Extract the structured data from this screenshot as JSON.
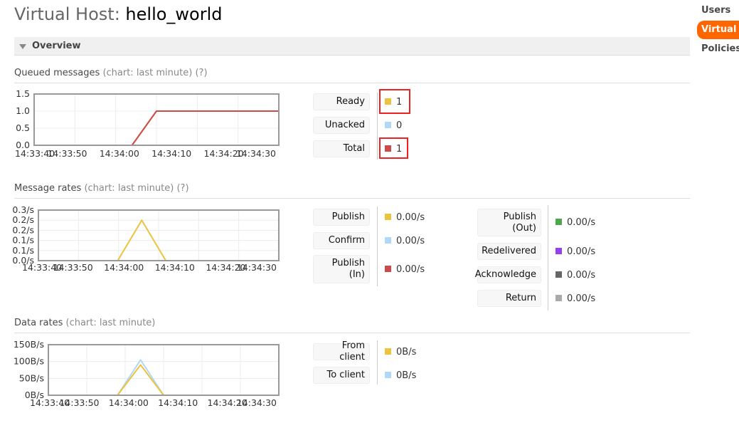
{
  "header": {
    "title_prefix": "Virtual Host: ",
    "vhost_name": "hello_world"
  },
  "nav": {
    "items": [
      "Users",
      "Virtual Hosts",
      "Policies"
    ],
    "active_index": 1
  },
  "overview": {
    "label": "Overview"
  },
  "queued": {
    "title": "Queued messages",
    "subtitle": "(chart: last minute)",
    "help": "(?)",
    "stats": [
      {
        "label": "Ready",
        "value": "1",
        "color": "#edc240",
        "highlight": true
      },
      {
        "label": "Unacked",
        "value": "0",
        "color": "#afd8f8",
        "highlight": false
      },
      {
        "label": "Total",
        "value": "1",
        "color": "#cb4b4b",
        "highlight": true
      }
    ]
  },
  "rates": {
    "title": "Message rates",
    "subtitle": "(chart: last minute)",
    "help": "(?)",
    "left_stats": [
      {
        "label": "Publish",
        "value": "0.00/s",
        "color": "#edc240"
      },
      {
        "label": "Confirm",
        "value": "0.00/s",
        "color": "#afd8f8"
      },
      {
        "label": "Publish (In)",
        "line1": "Publish",
        "line2": "(In)",
        "value": "0.00/s",
        "color": "#cb4b4b"
      }
    ],
    "right_stats": [
      {
        "label": "Publish (Out)",
        "line1": "Publish",
        "line2": "(Out)",
        "value": "0.00/s",
        "color": "#4da74d"
      },
      {
        "label": "Redelivered",
        "value": "0.00/s",
        "color": "#9440ed"
      },
      {
        "label": "Acknowledge",
        "value": "0.00/s",
        "color": "#666666"
      },
      {
        "label": "Return",
        "value": "0.00/s",
        "color": "#aaaaaa"
      }
    ]
  },
  "data_rates": {
    "title": "Data rates",
    "subtitle": "(chart: last minute)",
    "stats": [
      {
        "label": "From client",
        "value": "0B/s",
        "color": "#edc240"
      },
      {
        "label": "To client",
        "value": "0B/s",
        "color": "#afd8f8"
      }
    ]
  },
  "chart_data": [
    {
      "type": "line",
      "name": "queued-messages",
      "x_ticks": [
        "14:33:40",
        "14:33:50",
        "14:34:00",
        "14:34:10",
        "14:34:20",
        "14:34:30"
      ],
      "y_ticks": [
        "1.5",
        "1.0",
        "0.5",
        "0.0"
      ],
      "ylim": [
        0,
        1.5
      ],
      "x_seconds": [
        0,
        50
      ],
      "series": [
        {
          "name": "Unacked",
          "color": "#afd8f8",
          "points": [
            [
              0,
              0
            ],
            [
              50,
              0
            ]
          ]
        },
        {
          "name": "Ready",
          "color": "#edc240",
          "points": [
            [
              0,
              0
            ],
            [
              20,
              0
            ],
            [
              25,
              1
            ],
            [
              50,
              1
            ]
          ]
        },
        {
          "name": "Total",
          "color": "#cb4b4b",
          "points": [
            [
              0,
              0
            ],
            [
              20,
              0
            ],
            [
              25,
              1
            ],
            [
              50,
              1
            ]
          ]
        }
      ]
    },
    {
      "type": "line",
      "name": "message-rates",
      "x_ticks": [
        "14:33:40",
        "14:33:50",
        "14:34:00",
        "14:34:10",
        "14:34:20",
        "14:34:30"
      ],
      "y_ticks": [
        "0.3/s",
        "0.2/s",
        "0.2/s",
        "0.1/s",
        "0.1/s",
        "0.0/s"
      ],
      "ylim": [
        0,
        0.25
      ],
      "x_seconds": [
        0,
        50
      ],
      "series": [
        {
          "name": "Publish",
          "color": "#edc240",
          "points": [
            [
              16.5,
              0
            ],
            [
              21.5,
              0.2
            ],
            [
              26.5,
              0
            ]
          ]
        }
      ]
    },
    {
      "type": "line",
      "name": "data-rates",
      "x_ticks": [
        "14:33:40",
        "14:33:50",
        "14:34:00",
        "14:34:10",
        "14:34:20",
        "14:34:30"
      ],
      "y_ticks": [
        "150B/s",
        "100B/s",
        "50B/s",
        "0B/s"
      ],
      "ylim": [
        0,
        150
      ],
      "x_seconds": [
        0,
        50
      ],
      "series": [
        {
          "name": "To client",
          "color": "#afd8f8",
          "points": [
            [
              0,
              0
            ],
            [
              15,
              0
            ],
            [
              20,
              105
            ],
            [
              25,
              0
            ],
            [
              50,
              0
            ]
          ]
        },
        {
          "name": "From client",
          "color": "#edc240",
          "points": [
            [
              0,
              0
            ],
            [
              15,
              0
            ],
            [
              20,
              90
            ],
            [
              25,
              0
            ],
            [
              50,
              0
            ]
          ]
        }
      ]
    }
  ]
}
